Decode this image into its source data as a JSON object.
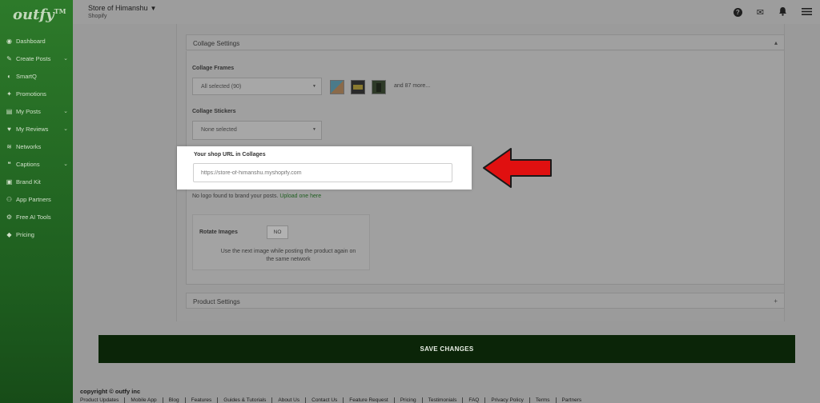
{
  "sidebar": {
    "logo": "outfy",
    "logo_tm": "TM",
    "items": [
      {
        "label": "Dashboard",
        "icon": "dashboard-icon",
        "has_chevron": false
      },
      {
        "label": "Create Posts",
        "icon": "edit-icon",
        "has_chevron": true
      },
      {
        "label": "SmartQ",
        "icon": "queue-icon",
        "has_chevron": false
      },
      {
        "label": "Promotions",
        "icon": "promo-icon",
        "has_chevron": false
      },
      {
        "label": "My Posts",
        "icon": "posts-icon",
        "has_chevron": true
      },
      {
        "label": "My Reviews",
        "icon": "heart-icon",
        "has_chevron": true
      },
      {
        "label": "Networks",
        "icon": "wifi-icon",
        "has_chevron": false
      },
      {
        "label": "Captions",
        "icon": "caption-icon",
        "has_chevron": true
      },
      {
        "label": "Brand Kit",
        "icon": "brand-icon",
        "has_chevron": false
      },
      {
        "label": "App Partners",
        "icon": "partners-icon",
        "has_chevron": false
      },
      {
        "label": "Free AI Tools",
        "icon": "ai-icon",
        "has_chevron": false
      },
      {
        "label": "Pricing",
        "icon": "tag-icon",
        "has_chevron": false
      }
    ]
  },
  "header": {
    "store_name": "Store of Himanshu",
    "platform": "Shopify"
  },
  "collage": {
    "section_title": "Collage Settings",
    "frames_label": "Collage Frames",
    "frames_value": "All selected (90)",
    "frames_more": "and 87 more...",
    "stickers_label": "Collage Stickers",
    "stickers_value": "None selected",
    "url_label": "Your shop URL in Collages",
    "url_placeholder": "https://store-of-himanshu.myshopify.com",
    "nologo_text": "No logo found to brand your posts.",
    "upload_link": "Upload one here",
    "rotate_label": "Rotate Images",
    "rotate_value": "NO",
    "rotate_note": "Use the next image while posting the product again on the same network"
  },
  "product": {
    "section_title": "Product Settings"
  },
  "save_label": "SAVE CHANGES",
  "footer": {
    "copyright": "copyright © outfy inc",
    "links": [
      "Product Updates",
      "Mobile App",
      "Blog",
      "Features",
      "Guides & Tutorials",
      "About Us",
      "Contact Us",
      "Feature Request",
      "Pricing",
      "Testimonials",
      "FAQ",
      "Privacy Policy",
      "Terms",
      "Partners"
    ]
  },
  "colors": {
    "sidebar": "#2d7a2a",
    "save_button": "#0b2508",
    "arrow": "#e01010",
    "link": "#1f5e20"
  }
}
